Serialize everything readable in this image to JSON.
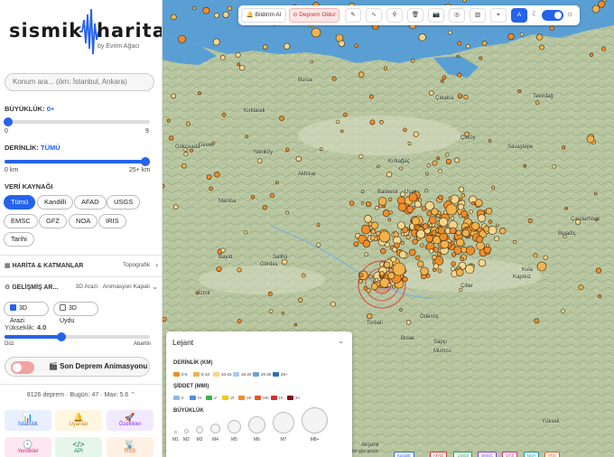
{
  "app": {
    "logo_left": "sismik",
    "logo_right": "harita",
    "logo_sub": "by Evrim Ağacı"
  },
  "search": {
    "placeholder": "Konum ara... (örn: İstanbul, Ankara)"
  },
  "magnitude": {
    "label": "BÜYÜKLÜK:",
    "value": "0+",
    "min": "0",
    "max": "9",
    "level": 0
  },
  "depth": {
    "label": "DERİNLİK:",
    "value": "TÜMÜ",
    "min": "0 km",
    "max": "25+ km",
    "level": 1
  },
  "sources": {
    "label": "VERİ KAYNAĞI",
    "items": [
      "Tümü",
      "Kandilli",
      "AFAD",
      "USGS",
      "EMSC",
      "GFZ",
      "NOA",
      "IRIS",
      "Tarihi"
    ],
    "selected": "Tümü"
  },
  "sections": {
    "map_layers": {
      "label": "HARİTA & KATMANLAR",
      "value": "Topografik"
    },
    "advanced": {
      "label": "GELİŞMİŞ AR...",
      "value": "3D Arazi · Animasyon Kapalı"
    }
  },
  "terrain": {
    "arazi_label": "3D Arazi",
    "arazi_checked": true,
    "uydu_label": "3D Uydu",
    "uydu_checked": false,
    "height_label": "Yükseklik:",
    "height_value": "4.0",
    "height_level": 0.4,
    "flat": "Düz",
    "exaggerated": "Abartılı"
  },
  "animation": {
    "label": "🎬 Son Deprem Animasyonu",
    "enabled": false
  },
  "stats": {
    "text": "8126 deprem · Bugün: 47 · Max: 5.6"
  },
  "tiles": [
    {
      "label": "İstatistik",
      "icon": "📊",
      "bg": "#e8efff",
      "color": "#2563eb"
    },
    {
      "label": "Uyarılar",
      "icon": "🔔",
      "bg": "#fff6e0",
      "color": "#d97706"
    },
    {
      "label": "Özellikler",
      "icon": "🚀",
      "bg": "#f3e9ff",
      "color": "#7c3aed"
    },
    {
      "label": "Yenilikler",
      "icon": "🕘",
      "bg": "#fde8f1",
      "color": "#db2777"
    },
    {
      "label": "API",
      "icon": "</>",
      "bg": "#e6f7ea",
      "color": "#15803d"
    },
    {
      "label": "RSS",
      "icon": "📡",
      "bg": "#fff1e3",
      "color": "#ea580c"
    }
  ],
  "toolbar": {
    "notify": "Bildirim Al",
    "report": "Deprem Oldu!",
    "icons": [
      "ruler-icon",
      "chart-icon",
      "pin-icon",
      "trash-icon",
      "camera-icon",
      "target-icon",
      "book-icon",
      "crosshair-icon",
      "font-icon",
      "moon-icon",
      "sun-icon"
    ]
  },
  "places": [
    "Bursa",
    "Çatalca",
    "Tekirdağ",
    "Kırklareli",
    "Çitköy",
    "Gökçeada",
    "Devell",
    "Yelniköy",
    "Akhisar",
    "Kırkağaç",
    "Balıkesir",
    "Kula",
    "Salihli",
    "Gördes",
    "Uşak",
    "Manisa",
    "İzmir",
    "Torbalı",
    "Ödemiş",
    "Bayat",
    "Kapıkız",
    "Sapçı",
    "Bulak",
    "Mumcu",
    "Yüksek",
    "Akşehir",
    "Çavdarhisar",
    "Bigadiç",
    "Savaştepe",
    "Çitler"
  ],
  "legend": {
    "title": "Lejant",
    "depth_title": "DERİNLİK (KM)",
    "depth": [
      {
        "label": "0-5",
        "color": "#f28c28"
      },
      {
        "label": "5-10",
        "color": "#f2b24c"
      },
      {
        "label": "10-15",
        "color": "#f7d68c"
      },
      {
        "label": "15-20",
        "color": "#a9cbe6"
      },
      {
        "label": "20-25",
        "color": "#6fa3d4"
      },
      {
        "label": "25+",
        "color": "#2f6fb3"
      }
    ],
    "intensity_title": "ŞİDDET (MMI)",
    "intensity": [
      {
        "label": "II",
        "color": "#8fb9e8"
      },
      {
        "label": "IV",
        "color": "#4c8fdc"
      },
      {
        "label": "V",
        "color": "#37b34a"
      },
      {
        "label": "VI",
        "color": "#f5c518"
      },
      {
        "label": "VII",
        "color": "#f28c28"
      },
      {
        "label": "VIII",
        "color": "#e8551f"
      },
      {
        "label": "IX",
        "color": "#d32f2f"
      },
      {
        "label": "X+",
        "color": "#8b0a1c"
      }
    ],
    "magnitude_title": "BÜYÜKLÜK",
    "magnitudes": [
      "M1",
      "M2",
      "M3",
      "M4",
      "M5",
      "M6",
      "M7",
      "M8+"
    ]
  },
  "sources_bar": {
    "label": "bir göz gezin:",
    "chips": [
      {
        "label": "Kandilli",
        "color": "#2563eb"
      },
      {
        "label": "AFAD",
        "color": "#dc2626"
      },
      {
        "label": "USGS",
        "color": "#16a34a"
      },
      {
        "label": "EMSC",
        "color": "#7c3aed"
      },
      {
        "label": "GFZ",
        "color": "#db2777"
      },
      {
        "label": "NOA",
        "color": "#0891b2"
      },
      {
        "label": "IRIS",
        "color": "#ea580c"
      }
    ]
  }
}
